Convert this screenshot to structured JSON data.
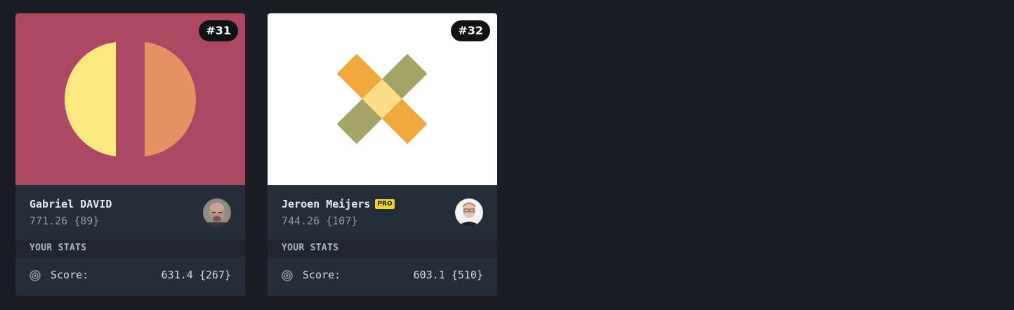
{
  "cards": [
    {
      "rank": "#31",
      "art": {
        "background": "#ad4862",
        "left_half_color": "#f9e97e",
        "right_half_color": "#e69066"
      },
      "author": {
        "name": "Gabriel DAVID",
        "score": "771.26 {89}",
        "pro": false
      },
      "stats_header": "YOUR STATS",
      "stats": {
        "icon": "target-icon",
        "label": "Score:",
        "value": "631.4 {267}"
      }
    },
    {
      "rank": "#32",
      "art": {
        "background": "#ffffff",
        "orange": "#f2a93b",
        "olive": "#a3a466",
        "center": "#fbdd8a"
      },
      "author": {
        "name": "Jeroen Meijers",
        "score": "744.26 {107}",
        "pro": true,
        "pro_label": "PRO"
      },
      "stats_header": "YOUR STATS",
      "stats": {
        "icon": "target-icon",
        "label": "Score:",
        "value": "603.1 {510}"
      }
    }
  ]
}
